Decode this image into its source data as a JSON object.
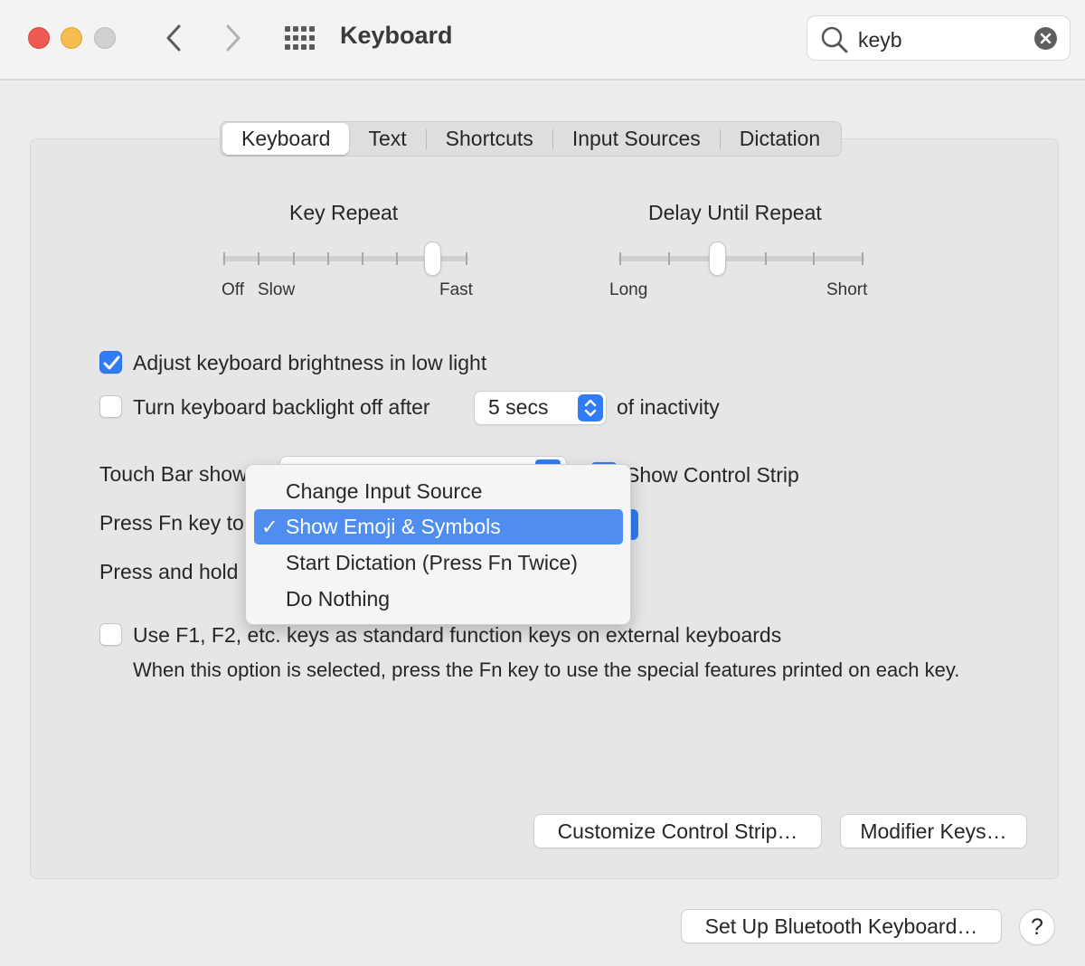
{
  "window": {
    "title": "Keyboard",
    "search": {
      "value": "keyb"
    }
  },
  "tabs": [
    {
      "label": "Keyboard",
      "active": true
    },
    {
      "label": "Text",
      "active": false
    },
    {
      "label": "Shortcuts",
      "active": false
    },
    {
      "label": "Input Sources",
      "active": false
    },
    {
      "label": "Dictation",
      "active": false
    }
  ],
  "key_repeat": {
    "title": "Key Repeat",
    "labels": {
      "off": "Off",
      "slow": "Slow",
      "fast": "Fast"
    },
    "ticks": 8,
    "level": 0.857
  },
  "delay_until_repeat": {
    "title": "Delay Until Repeat",
    "labels": {
      "long": "Long",
      "short": "Short"
    },
    "ticks": 6,
    "level": 0.4
  },
  "options": {
    "adjust_brightness": {
      "label": "Adjust keyboard brightness in low light",
      "checked": true
    },
    "backlight_off": {
      "label": "Turn keyboard backlight off after",
      "checked": false,
      "value": "5 secs",
      "suffix": "of inactivity"
    },
    "touch_bar": {
      "label": "Touch Bar show",
      "show_control_strip": "Show Control Strip"
    },
    "fn_key": {
      "label": "Press Fn key to"
    },
    "press_hold": {
      "label": "Press and hold"
    },
    "function_keys": {
      "label": "Use F1, F2, etc. keys as standard function keys on external keyboards",
      "checked": false,
      "note": "When this option is selected, press the Fn key to use the special features printed on each key."
    }
  },
  "fn_menu": {
    "items": [
      {
        "label": "Change Input Source",
        "selected": false
      },
      {
        "label": "Show Emoji & Symbols",
        "selected": true
      },
      {
        "label": "Start Dictation (Press Fn Twice)",
        "selected": false
      },
      {
        "label": "Do Nothing",
        "selected": false
      }
    ],
    "check_glyph": "✓"
  },
  "buttons": {
    "customize_control_strip": "Customize Control Strip…",
    "modifier_keys": "Modifier Keys…",
    "bluetooth_keyboard": "Set Up Bluetooth Keyboard…",
    "help": "?"
  },
  "colors": {
    "accent": "#2f7cf6",
    "menu_highlight": "#4f8ef0",
    "close": "#ee5a52",
    "minimize": "#f5bd4f",
    "zoom_inactive": "#d0d0d0"
  }
}
